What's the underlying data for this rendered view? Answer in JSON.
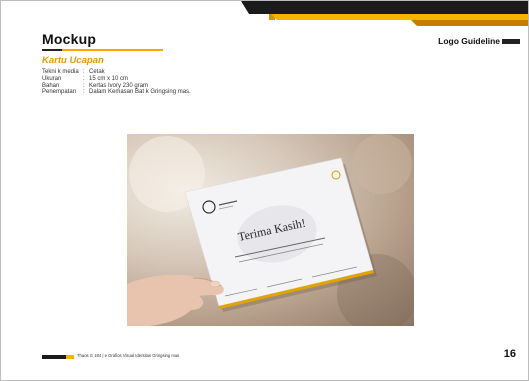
{
  "header": {
    "title": "Mockup",
    "guide_label": "Logo Guideline"
  },
  "section": {
    "subtitle": "Kartu Ucapan",
    "specs": [
      {
        "label": "Tekni k media",
        "value": "Cetak"
      },
      {
        "label": "Ukuran",
        "value": "15 cm x 10 cm"
      },
      {
        "label": "Bahan",
        "value": "Kertas Ivory 230 gram"
      },
      {
        "label": "Penempatan",
        "value": "Dalam Kemasan Bat k Gringsing mas."
      }
    ]
  },
  "card": {
    "heading": "Terima Kasih!"
  },
  "footer": {
    "text": "Thaos G 184 | e Grafios Visual Identitas Gringsing mas",
    "page_number": "16"
  },
  "colors": {
    "accent": "#f5b400",
    "dark": "#1b1b1b",
    "subtitle": "#e39b00"
  }
}
